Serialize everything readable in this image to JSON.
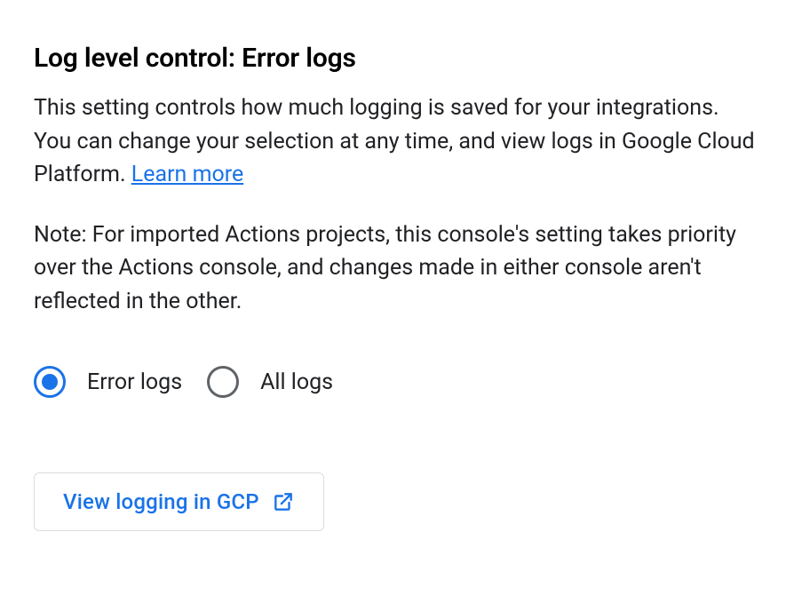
{
  "heading": "Log level control: Error logs",
  "description_pre": "This setting controls how much logging is saved for your integrations. You can change your selection at any time, and view logs in Google Cloud Platform. ",
  "learn_more": "Learn more",
  "note": "Note: For imported Actions projects, this console's setting takes priority over the Actions console, and changes made in either console aren't reflected in the other.",
  "radio": {
    "error_logs": "Error logs",
    "all_logs": "All logs",
    "selected": "error_logs"
  },
  "button": {
    "label": "View logging in GCP"
  }
}
